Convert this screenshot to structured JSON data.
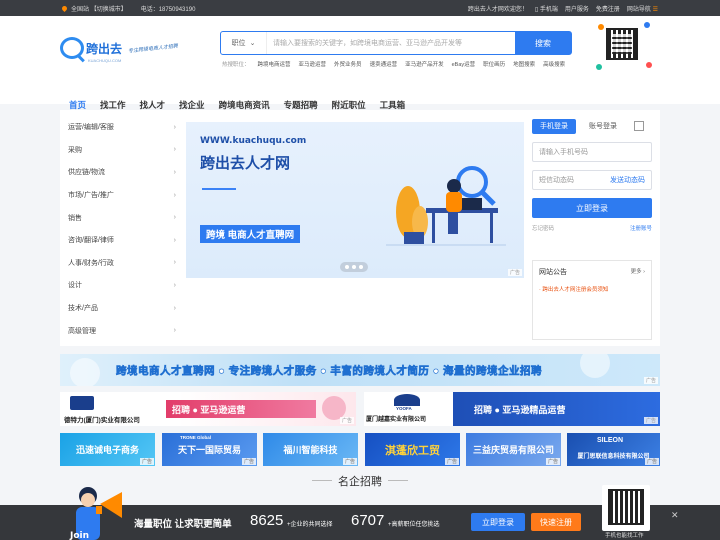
{
  "topbar": {
    "location": "全国站",
    "switch_city": "【切换城市】",
    "phone": "电话：18750943190",
    "welcome": "跨出去人才网欢迎您！",
    "mobile": "手机端",
    "user_service": "用户服务",
    "free_register": "免费注册",
    "site_nav": "网站导航"
  },
  "header": {
    "logo_text": "跨出去",
    "logo_sub": "KUACHUQU.COM",
    "slogan": "专注跨境电商人才招聘",
    "search_type": "职位",
    "search_placeholder": "请输入要搜索的关键字，如跨境电商运营、亚马逊产品开发等",
    "search_button": "搜索",
    "hot_label": "热搜职位：",
    "hot_terms": [
      "跨境电商运营",
      "亚马逊运营",
      "外贸业务员",
      "速卖通运营",
      "亚马逊产品开发",
      "eBay运营",
      "职位画历",
      "地图搜索",
      "高级搜索"
    ]
  },
  "nav": [
    "首页",
    "找工作",
    "找人才",
    "找企业",
    "跨境电商资讯",
    "专题招聘",
    "附近职位",
    "工具箱"
  ],
  "categories": [
    "运营/编辑/客服",
    "采购",
    "供应链/物流",
    "市场/广告/推广",
    "销售",
    "咨询/翻译/律师",
    "人事/财务/行政",
    "设计",
    "技术/产品",
    "高级管理"
  ],
  "banner": {
    "url": "WWW.kuachuqu.com",
    "title": "跨出去人才网",
    "subtitle": "跨境 电商人才直聘网",
    "ad": "广告"
  },
  "login": {
    "tab_mobile": "手机登录",
    "tab_account": "账号登录",
    "phone_placeholder": "请输入手机号码",
    "sms_placeholder": "短信动态码",
    "send_code": "发送动态码",
    "submit": "立即登录",
    "forgot": "忘记密码",
    "register": "注册账号"
  },
  "notice": {
    "title": "网站公告",
    "more": "更多",
    "items": [
      "跨出去人才网注册会员须知"
    ]
  },
  "wide_banner": {
    "text": "跨境电商人才直聘网 ● 专注跨境人才服务 ● 丰富的跨境人才简历 ● 海量的跨境企业招聘",
    "ad": "广告"
  },
  "company_ads_row1": [
    {
      "company": "德特力(厦门)实业有限公司",
      "job": "招聘 ● 亚马逊运营",
      "ad": "广告"
    },
    {
      "company": "厦门越嘉实业有限公司",
      "brand": "YOOFA",
      "job": "招聘 ● 亚马逊精品运营",
      "ad": "广告"
    }
  ],
  "company_ads_row2": [
    {
      "text": "迅速诚电子商务",
      "ad": "广告"
    },
    {
      "text": "天下一国际贸易",
      "brand": "TRONE Global",
      "ad": "广告"
    },
    {
      "text": "福川智能科技",
      "ad": "广告"
    },
    {
      "text": "淇蓬欣工贸",
      "ad": "广告"
    },
    {
      "text": "三益庆贸易有限公司",
      "ad": "广告"
    },
    {
      "text": "厦门思联信息科技有限公司",
      "brand": "SILEON",
      "ad": "广告"
    }
  ],
  "section_title": "名企招聘",
  "bottom_bar": {
    "slogan": "海量职位 让求职更简单",
    "companies_count": "8625",
    "companies_desc": "+企业的共同选择",
    "resumes_count": "6707",
    "resumes_desc": "+高薪职位任您挑选",
    "login_button": "立即登录",
    "register_button": "快速注册",
    "qr_caption": "手机也能找工作",
    "close": "✕"
  },
  "colors": {
    "primary": "#2e7bf0",
    "accent": "#ff7a1a",
    "notice": "#e8500f",
    "topbar": "#3a3d42"
  }
}
